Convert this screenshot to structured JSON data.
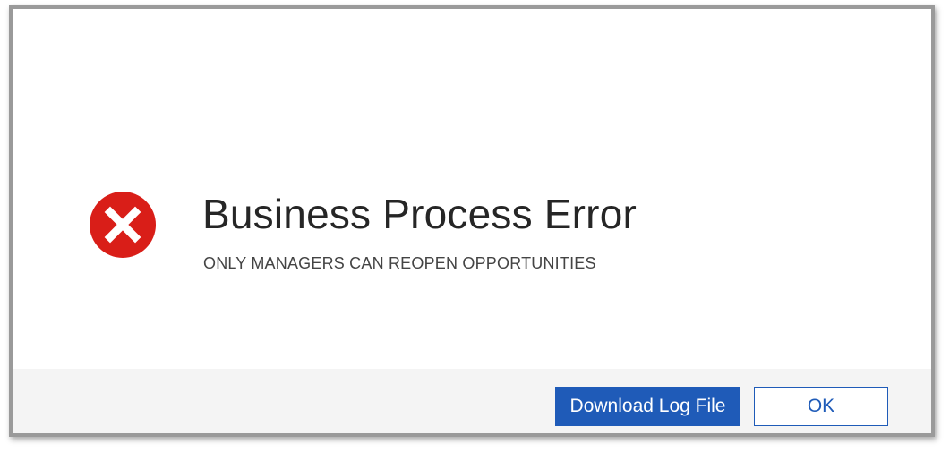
{
  "dialog": {
    "title": "Business Process Error",
    "message": "ONLY MANAGERS CAN REOPEN OPPORTUNITIES",
    "icon": "error-circle-x-icon",
    "icon_color": "#d91e18"
  },
  "footer": {
    "download_label": "Download Log File",
    "ok_label": "OK"
  },
  "colors": {
    "accent": "#1f5bb8",
    "footer_bg": "#f4f4f4"
  }
}
